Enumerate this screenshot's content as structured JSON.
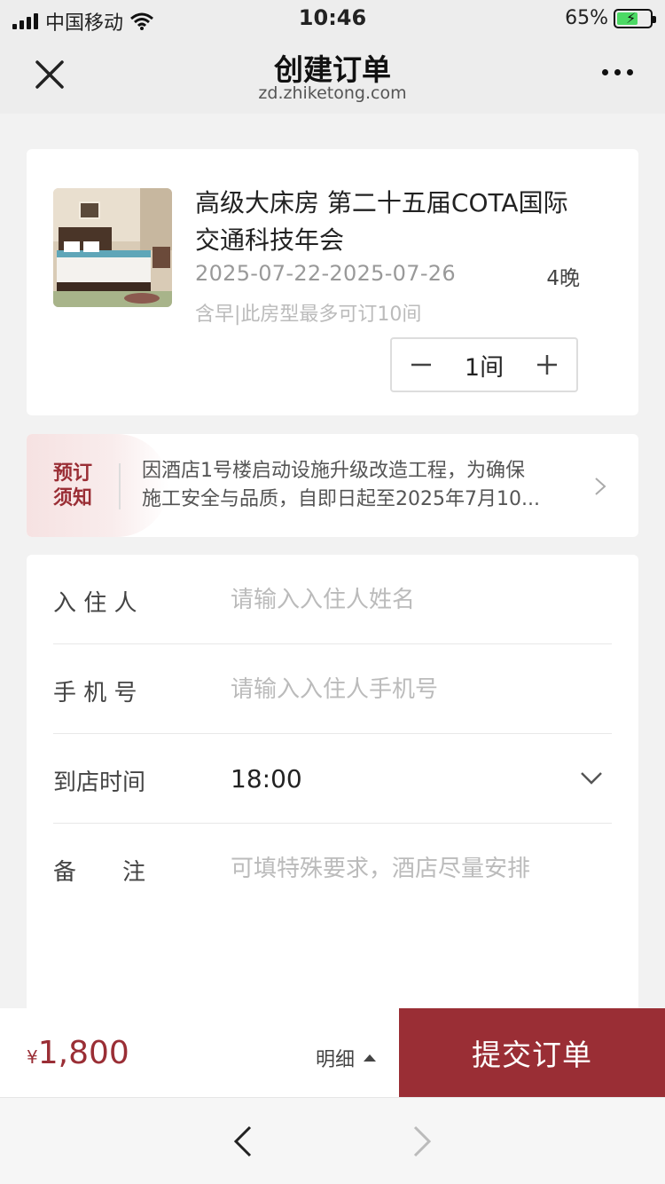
{
  "status": {
    "carrier": "中国移动",
    "time": "10:46",
    "battery": "65%"
  },
  "nav": {
    "title": "创建订单",
    "url": "zd.zhiketong.com"
  },
  "room": {
    "name": "高级大床房 第二十五届COTA国际交通科技年会",
    "dates": "2025-07-22-2025-07-26",
    "nights": "4晚",
    "note": "含早|此房型最多可订10间",
    "quantity": "1间"
  },
  "notice": {
    "badge_line1": "预订",
    "badge_line2": "须知",
    "line1": "因酒店1号楼启动设施升级改造工程，为确保",
    "line2": "施工安全与品质，自即日起至2025年7月10..."
  },
  "form": {
    "guest": {
      "label": "入 住 人",
      "placeholder": "请输入入住人姓名"
    },
    "phone": {
      "label": "手 机 号",
      "placeholder": "请输入入住人手机号"
    },
    "arrival": {
      "label": "到店时间",
      "value": "18:00"
    },
    "remark": {
      "label": "备　　注",
      "placeholder": "可填特殊要求，酒店尽量安排"
    }
  },
  "footer": {
    "currency": "¥",
    "price": "1,800",
    "detail": "明细",
    "submit": "提交订单"
  },
  "colors": {
    "accent": "#9a2e35",
    "page_bg": "#f2f2f2"
  }
}
